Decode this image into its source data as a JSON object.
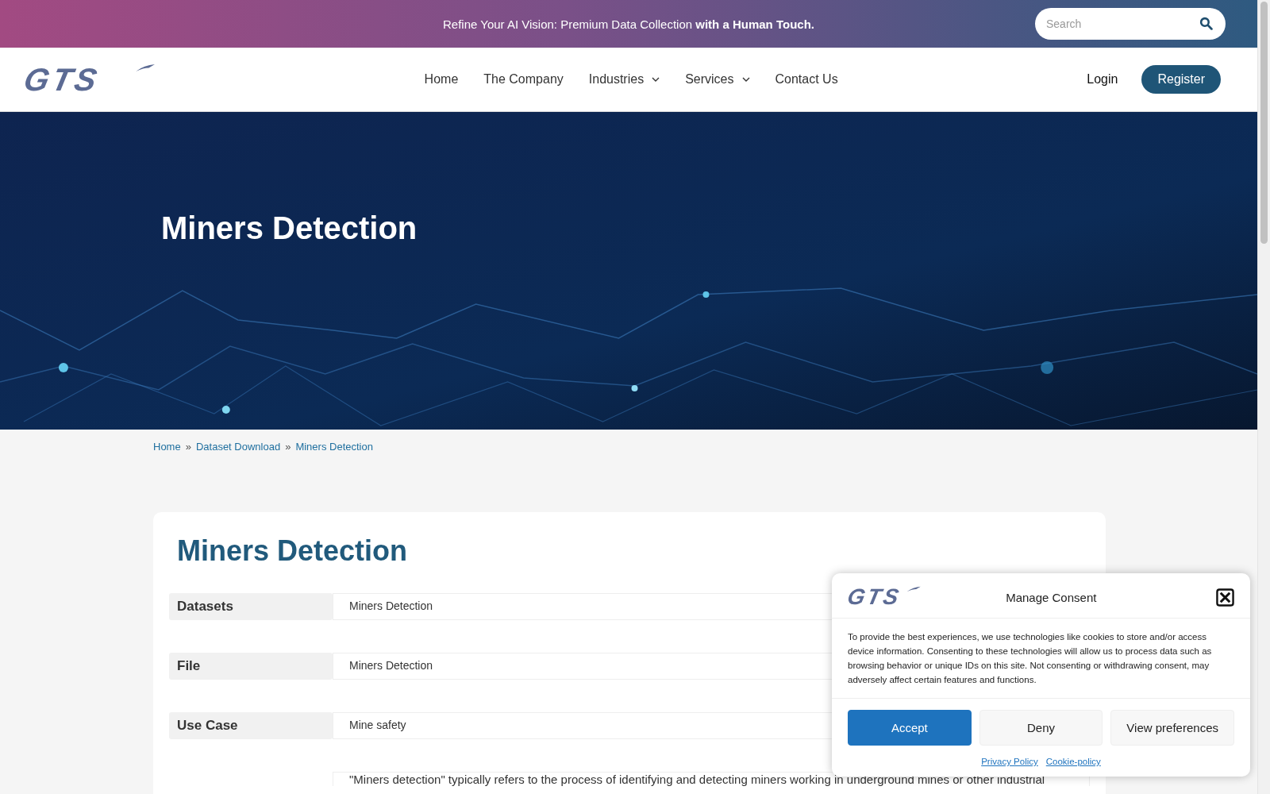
{
  "top_bar": {
    "message": "Refine Your AI Vision: Premium Data Collection **with a Human Touch.**",
    "search": {
      "placeholder": "Search"
    }
  },
  "header": {
    "logo": "GTS",
    "nav": [
      {
        "label": "Home",
        "dropdown": false
      },
      {
        "label": "The Company",
        "dropdown": false
      },
      {
        "label": "Industries",
        "dropdown": true
      },
      {
        "label": "Services",
        "dropdown": true
      },
      {
        "label": "Contact Us",
        "dropdown": false
      }
    ],
    "login": "Login",
    "register": "Register"
  },
  "hero": {
    "title": "Miners Detection"
  },
  "breadcrumb": [
    {
      "label": "Home",
      "kind": "link"
    },
    {
      "label": "»",
      "kind": "separator"
    },
    {
      "label": "Dataset Download",
      "kind": "link"
    },
    {
      "label": "»",
      "kind": "separator"
    },
    {
      "label": "Miners Detection",
      "kind": "link"
    }
  ],
  "card": {
    "title": "Miners Detection",
    "rows": [
      {
        "label": "Datasets",
        "value": "Miners Detection"
      },
      {
        "label": "File",
        "value": "Miners Detection"
      },
      {
        "label": "Use Case",
        "value": "Mine safety"
      }
    ],
    "description": "\"Miners detection\" typically refers to the process of identifying and detecting miners working in underground mines or other industrial"
  },
  "consent": {
    "logo": "GTS",
    "title": "Manage Consent",
    "text": "To provide the best experiences, we use technologies like cookies to store and/or access device information. Consenting to these technologies will allow us to process data such as browsing behavior or unique IDs on this site. Not consenting or withdrawing consent, may adversely affect certain features and functions.",
    "buttons": [
      {
        "label": "Accept",
        "kind": "primary"
      },
      {
        "label": "Deny",
        "kind": "secondary"
      },
      {
        "label": "View preferences",
        "kind": "secondary"
      }
    ],
    "links": [
      "Privacy Policy",
      "Cookie-policy"
    ]
  }
}
